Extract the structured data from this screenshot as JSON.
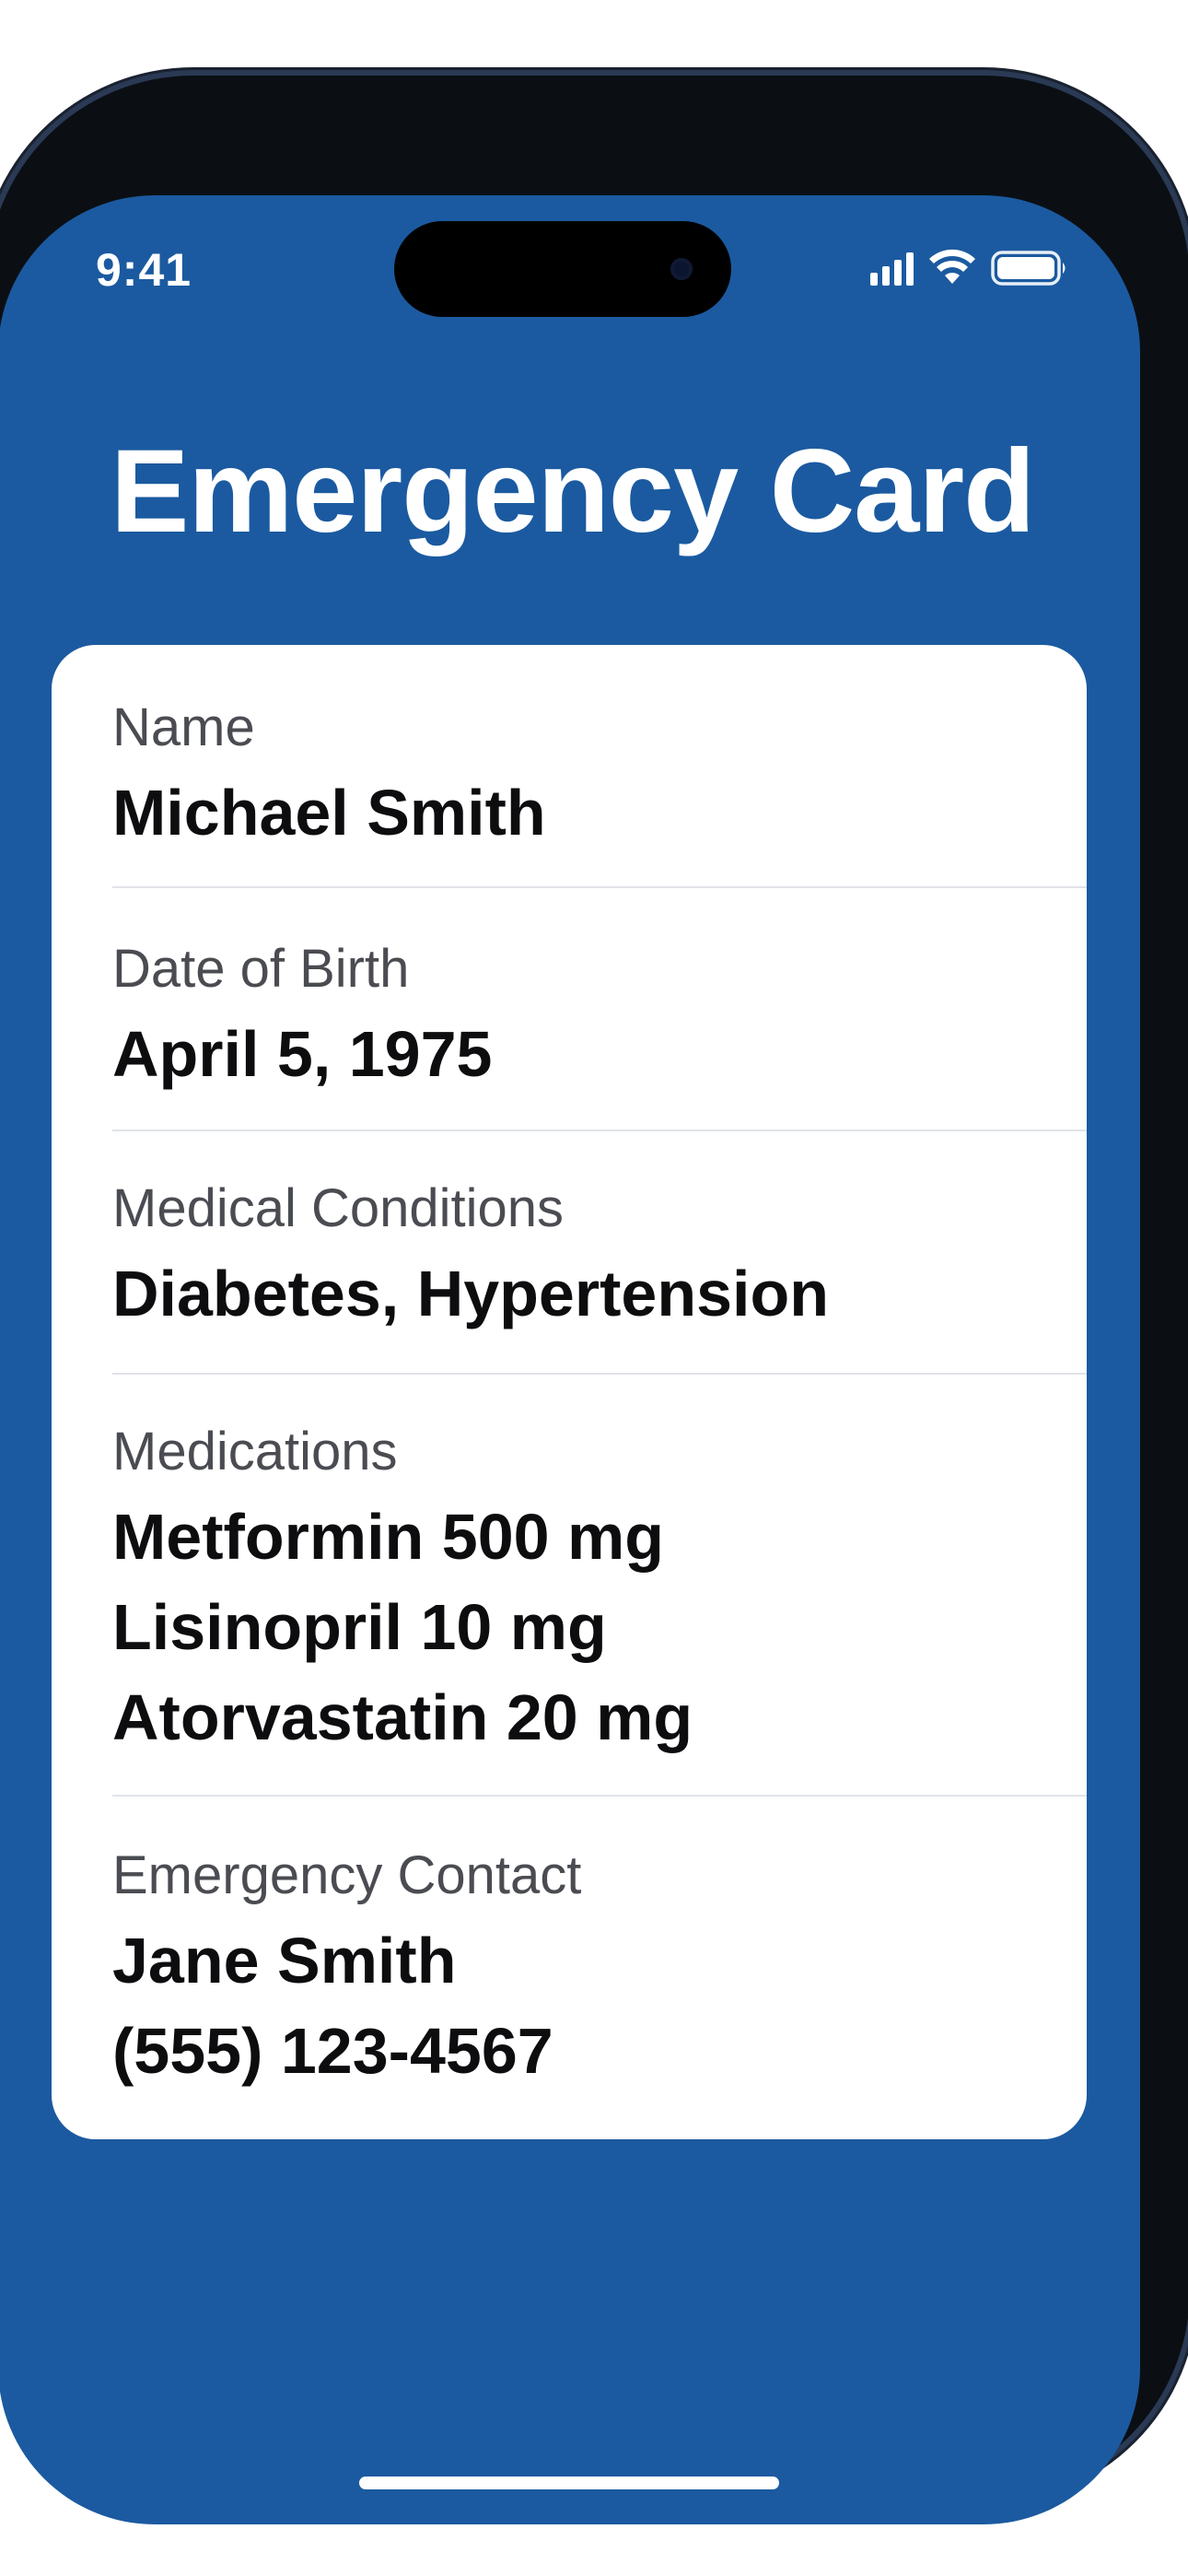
{
  "status_bar": {
    "time": "9:41"
  },
  "header": {
    "title": "Emergency Card"
  },
  "card": {
    "name_label": "Name",
    "name_value": "Michael Smith",
    "dob_label": "Date of Birth",
    "dob_value": "April 5, 1975",
    "conditions_label": "Medical Conditions",
    "conditions_value": "Diabetes, Hypertension",
    "medications_label": "Medications",
    "medications": [
      "Metformin 500 mg",
      "Lisinopril 10 mg",
      "Atorvastatin 20 mg"
    ],
    "contact_label": "Emergency Contact",
    "contact_name": "Jane Smith",
    "contact_phone": "(555) 123-4567"
  },
  "colors": {
    "background": "#1b5aa0",
    "card": "#ffffff",
    "label": "#4a4c52",
    "value": "#0d0d0f"
  },
  "icons": [
    "cellular-signal-icon",
    "wifi-icon",
    "battery-icon"
  ]
}
